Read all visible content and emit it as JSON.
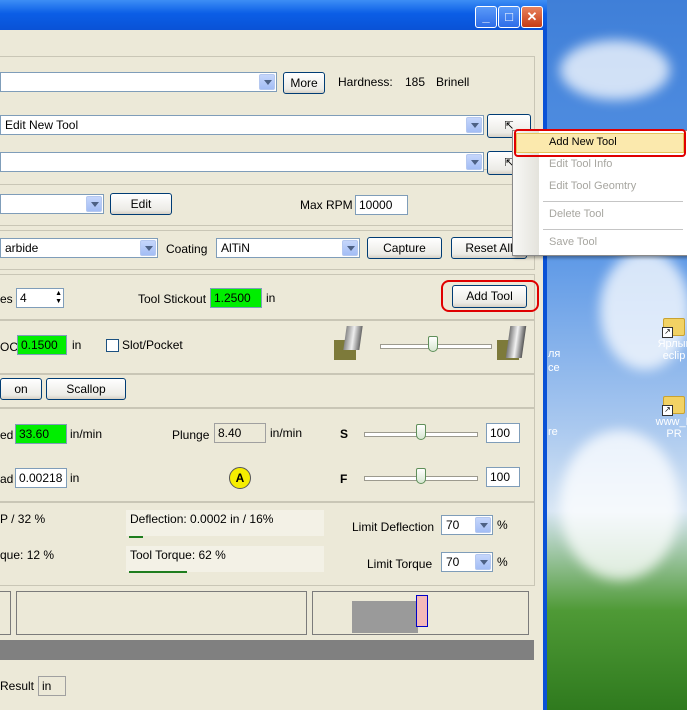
{
  "window": {
    "controls": {
      "minimize": "_",
      "maximize": "□",
      "close": "✕"
    }
  },
  "material_row": {
    "more_label": "More",
    "hardness_label": "Hardness:",
    "hardness_value": "185",
    "hardness_unit": "Brinell"
  },
  "tool_row": {
    "selected": "Edit New Tool"
  },
  "holder_row": {
    "edit_label": "Edit",
    "max_rpm_label": "Max RPM",
    "max_rpm_value": "10000"
  },
  "material2_row": {
    "tool_material": "arbide",
    "coating_label": "Coating",
    "coating_value": "AlTiN",
    "capture_label": "Capture",
    "reset_all_label": "Reset All"
  },
  "flutes_row": {
    "label_fragment": "es",
    "flutes_value": "4",
    "stickout_label": "Tool Stickout",
    "stickout_value": "1.2500",
    "stickout_unit": "in",
    "add_tool_label": "Add Tool"
  },
  "doc_row": {
    "label_fragment": "OC",
    "doc_value": "0.1500",
    "doc_unit": "in",
    "slot_pocket_label": "Slot/Pocket"
  },
  "tabs_row": {
    "tab1_fragment": "on",
    "scallop_label": "Scallop"
  },
  "feed_row": {
    "feed_fragment": "ed",
    "feed_value": "33.60",
    "feed_unit": "in/min",
    "plunge_label": "Plunge",
    "plunge_value": "8.40",
    "plunge_unit": "in/min",
    "s_label": "S",
    "s_value": "100"
  },
  "chipload_row": {
    "chip_fragment": "ad",
    "chip_value": "0.00218",
    "chip_unit": "in",
    "badge": "A",
    "f_label": "F",
    "f_value": "100"
  },
  "results": {
    "hp_fragment": "P / 32 %",
    "deflection_text": "Deflection: 0.0002 in / 16%",
    "limit_deflection_label": "Limit Deflection",
    "limit_deflection_value": "70",
    "pct1": "%",
    "torque_fragment": "que: 12 %",
    "tool_torque_text": "Tool Torque: 62 %",
    "limit_torque_label": "Limit Torque",
    "limit_torque_value": "70",
    "pct2": "%"
  },
  "bottom": {
    "result_label": "Result",
    "result_unit": "in"
  },
  "context_menu": {
    "items": [
      "Add New Tool",
      "Edit Tool Info",
      "Edit Tool Geomtry",
      "Delete Tool",
      "Save Tool"
    ]
  },
  "desktop": {
    "text_fragments": [
      "ля",
      "ce",
      "re"
    ],
    "icons": [
      {
        "label1": "Ярлык",
        "label2": "eclip"
      },
      {
        "label1": "www_F",
        "label2": "PR"
      }
    ]
  }
}
